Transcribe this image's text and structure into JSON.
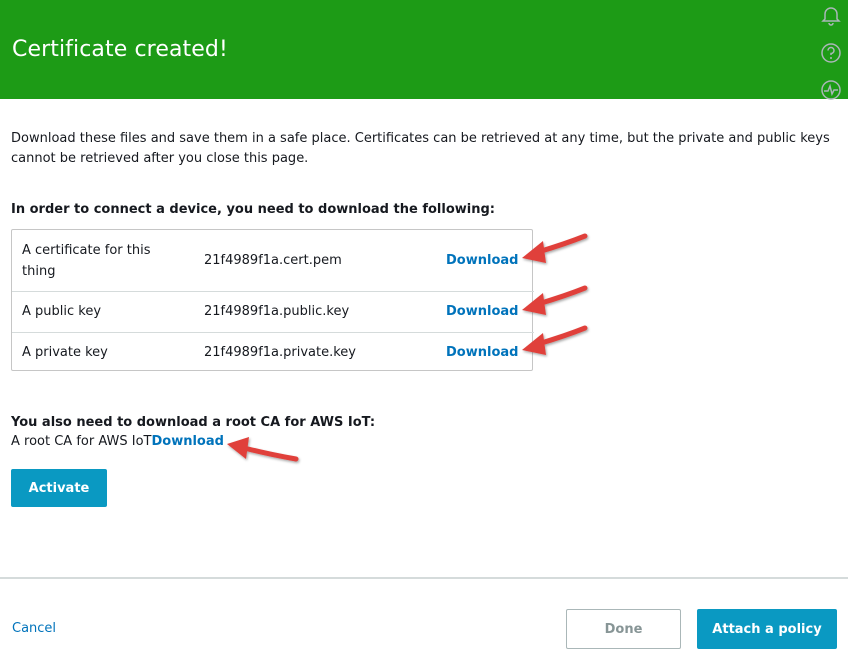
{
  "banner": {
    "title": "Certificate created!",
    "color": "#1d9b16",
    "icons": [
      "bell-icon",
      "help-icon",
      "activity-icon"
    ]
  },
  "intro_text": "Download these files and save them in a safe place. Certificates can be retrieved at any time, but the private and public keys cannot be retrieved after you close this page.",
  "device_section": {
    "heading": "In order to connect a device, you need to download the following:",
    "files": [
      {
        "description": "A certificate for this thing",
        "filename": "21f4989f1a.cert.pem",
        "action": "Download"
      },
      {
        "description": "A public key",
        "filename": "21f4989f1a.public.key",
        "action": "Download"
      },
      {
        "description": "A private key",
        "filename": "21f4989f1a.private.key",
        "action": "Download"
      }
    ]
  },
  "root_ca_section": {
    "heading": "You also need to download a root CA for AWS IoT:",
    "label": "A root CA for AWS IoT",
    "action": "Download"
  },
  "activate_label": "Activate",
  "footer": {
    "cancel_label": "Cancel",
    "done_label": "Done",
    "attach_label": "Attach a policy"
  },
  "colors": {
    "link": "#0073bb",
    "primary_button": "#0a99c2",
    "annotation_arrow": "#e0403a"
  }
}
